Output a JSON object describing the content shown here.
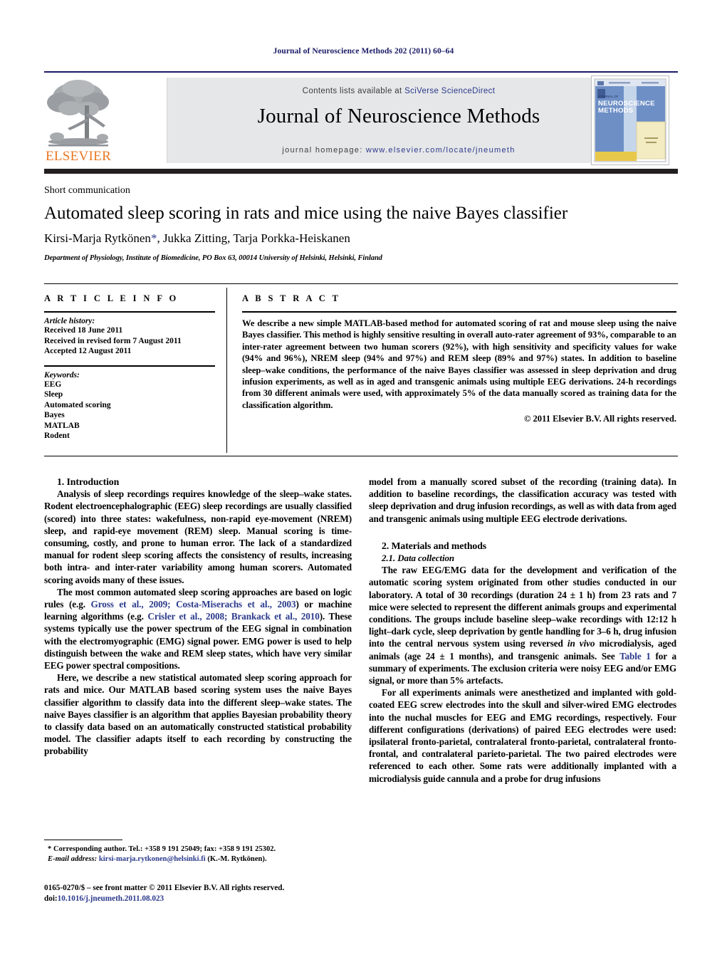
{
  "running_head": "Journal of Neuroscience Methods 202 (2011) 60–64",
  "masthead": {
    "contents_prefix": "Contents lists available at ",
    "contents_link": "SciVerse ScienceDirect",
    "journal_title": "Journal of Neuroscience Methods",
    "homepage_prefix": "journal homepage: ",
    "homepage_url": "www.elsevier.com/locate/jneumeth",
    "publisher_word": "ELSEVIER",
    "cover_line1": "JOURNAL OF",
    "cover_line2": "NEUROSCIENCE",
    "cover_line3": "METHODS",
    "colors": {
      "rule_blue": "#1a1a66",
      "banner_gray": "#e6e7e8",
      "link_blue": "#2b3a8c",
      "elsevier_orange": "#e87722",
      "cover_blue": "#6b8fc9",
      "cover_yellow": "#f0e2a8",
      "black_bar": "#231f20"
    }
  },
  "title_block": {
    "kicker": "Short communication",
    "title": "Automated sleep scoring in rats and mice using the naive Bayes classifier",
    "authors_pre": "Kirsi-Marja Rytkönen",
    "authors_star": "*",
    "authors_post": ", Jukka Zitting, Tarja Porkka-Heiskanen",
    "affiliation": "Department of Physiology, Institute of Biomedicine, PO Box 63, 00014 University of Helsinki, Helsinki, Finland"
  },
  "article_info": {
    "heading": "A R T I C L E  I N F O",
    "history_label": "Article history:",
    "history": [
      "Received 18 June 2011",
      "Received in revised form 7 August 2011",
      "Accepted 12 August 2011"
    ],
    "keywords_label": "Keywords:",
    "keywords": [
      "EEG",
      "Sleep",
      "Automated scoring",
      "Bayes",
      "MATLAB",
      "Rodent"
    ]
  },
  "abstract": {
    "heading": "A B S T R A C T",
    "body": "We describe a new simple MATLAB-based method for automated scoring of rat and mouse sleep using the naive Bayes classifier. This method is highly sensitive resulting in overall auto-rater agreement of 93%, comparable to an inter-rater agreement between two human scorers (92%), with high sensitivity and specificity values for wake (94% and 96%), NREM sleep (94% and 97%) and REM sleep (89% and 97%) states. In addition to baseline sleep–wake conditions, the performance of the naive Bayes classifier was assessed in sleep deprivation and drug infusion experiments, as well as in aged and transgenic animals using multiple EEG derivations. 24-h recordings from 30 different animals were used, with approximately 5% of the data manually scored as training data for the classification algorithm.",
    "copyright": "© 2011 Elsevier B.V. All rights reserved."
  },
  "body": {
    "intro_heading": "1.  Introduction",
    "intro_p1": "Analysis of sleep recordings requires knowledge of the sleep–wake states. Rodent electroencephalographic (EEG) sleep recordings are usually classified (scored) into three states: wakefulness, non-rapid eye-movement (NREM) sleep, and rapid-eye movement (REM) sleep. Manual scoring is time-consuming, costly, and prone to human error. The lack of a standardized manual for rodent sleep scoring affects the consistency of results, increasing both intra- and inter-rater variability among human scorers. Automated scoring avoids many of these issues.",
    "intro_p2_a": "The most common automated sleep scoring approaches are based on logic rules (e.g. ",
    "intro_p2_ref1": "Gross et al., 2009; Costa-Miserachs et al., 2003",
    "intro_p2_b": ") or machine learning algorithms (e.g. ",
    "intro_p2_ref2": "Crisler et al., 2008; Brankack et al., 2010",
    "intro_p2_c": "). These systems typically use the power spectrum of the EEG signal in combination with the electromyographic (EMG) signal power. EMG power is used to help distinguish between the wake and REM sleep states, which have very similar EEG power spectral compositions.",
    "intro_p3": "Here, we describe a new statistical automated sleep scoring approach for rats and mice. Our MATLAB based scoring system uses the naive Bayes classifier algorithm to classify data into the different sleep–wake states. The naive Bayes classifier is an algorithm that applies Bayesian probability theory to classify data based on an automatically constructed statistical probability model. The classifier adapts itself to each recording by constructing the probability",
    "right_p1": "model from a manually scored subset of the recording (training data). In addition to baseline recordings, the classification accuracy was tested with sleep deprivation and drug infusion recordings, as well as with data from aged and transgenic animals using multiple EEG electrode derivations.",
    "methods_heading": "2.  Materials and methods",
    "data_collection_heading": "2.1.  Data collection",
    "dc_p1_a": "The raw EEG/EMG data for the development and verification of the automatic scoring system originated from other studies conducted in our laboratory. A total of 30 recordings (duration 24 ± 1 h) from 23 rats and 7 mice were selected to represent the different animals groups and experimental conditions. The groups include baseline sleep–wake recordings with 12:12 h light–dark cycle, sleep deprivation by gentle handling for 3–6 h, drug infusion into the central nervous system using reversed ",
    "dc_p1_it": "in vivo",
    "dc_p1_b": " microdialysis, aged animals (age 24 ± 1 months), and transgenic animals. See ",
    "dc_p1_ref": "Table 1",
    "dc_p1_c": " for a summary of experiments. The exclusion criteria were noisy EEG and/or EMG signal, or more than 5% artefacts.",
    "dc_p2": "For all experiments animals were anesthetized and implanted with gold-coated EEG screw electrodes into the skull and silver-wired EMG electrodes into the nuchal muscles for EEG and EMG recordings, respectively. Four different configurations (derivations) of paired EEG electrodes were used: ipsilateral fronto-parietal, contralateral fronto-parietal, contralateral fronto-frontal, and contralateral parieto-parietal. The two paired electrodes were referenced to each other. Some rats were additionally implanted with a microdialysis guide cannula and a probe for drug infusions"
  },
  "footer": {
    "corresponding_marker": "*",
    "corresponding": "Corresponding author. Tel.: +358 9 191 25049; fax: +358 9 191 25302.",
    "email_label": "E-mail address:",
    "email": "kirsi-marja.rytkonen@helsinki.fi",
    "email_suffix": "(K.-M. Rytkönen).",
    "imprint_line1": "0165-0270/$ – see front matter © 2011 Elsevier B.V. All rights reserved.",
    "imprint_doi_label": "doi:",
    "imprint_doi": "10.1016/j.jneumeth.2011.08.023"
  }
}
